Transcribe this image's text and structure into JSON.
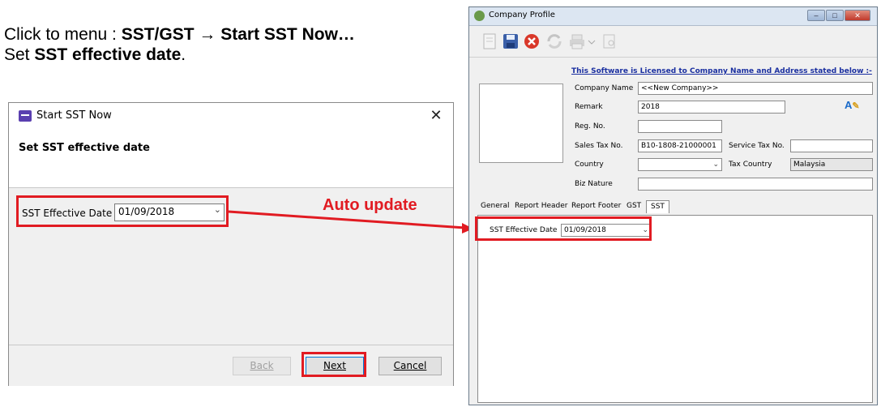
{
  "instruction": {
    "line1_prefix": "Click to menu : ",
    "line1_menu": "SST/GST → Start SST Now…",
    "line2_prefix": "Set ",
    "line2_bold": "SST effective date",
    "line2_suffix": "."
  },
  "wizard": {
    "title": "Start SST Now",
    "heading": "Set SST effective date",
    "close_glyph": "✕",
    "field_label": "SST Effective Date",
    "date_value": "01/09/2018",
    "buttons": {
      "back": "Back",
      "next": "Next",
      "cancel": "Cancel"
    },
    "back_enabled": false
  },
  "annotation": {
    "label": "Auto update",
    "color": "#e11b22"
  },
  "company_profile": {
    "title": "Company Profile",
    "license_text": "This Software is Licensed to Company Name and Address stated below :-",
    "fields": {
      "company_name": {
        "label": "Company Name",
        "value": "<<New Company>>"
      },
      "remark": {
        "label": "Remark",
        "value": "2018"
      },
      "reg_no": {
        "label": "Reg. No.",
        "value": ""
      },
      "sales_tax_no": {
        "label": "Sales Tax No.",
        "value": "B10-1808-21000001"
      },
      "service_tax_no": {
        "label": "Service Tax No.",
        "value": ""
      },
      "country": {
        "label": "Country",
        "value": ""
      },
      "tax_country": {
        "label": "Tax Country",
        "value": "Malaysia"
      },
      "biz_nature": {
        "label": "Biz Nature",
        "value": ""
      }
    },
    "tabs": [
      "General",
      "Report Header",
      "Report Footer",
      "GST",
      "SST"
    ],
    "active_tab": "SST",
    "sst_panel": {
      "label": "SST Effective Date",
      "value": "01/09/2018"
    }
  }
}
